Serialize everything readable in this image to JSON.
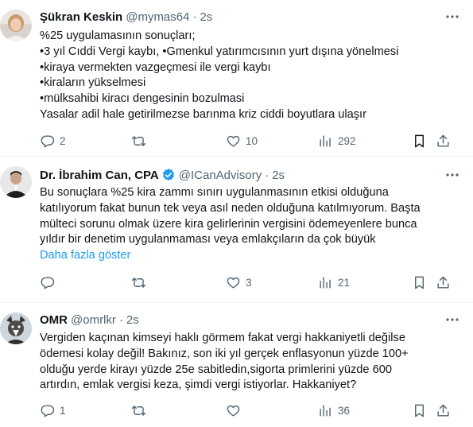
{
  "tweets": [
    {
      "name": "Şükran Keskin",
      "handle": "@mymas64",
      "dot": "·",
      "time": "2s",
      "lines": [
        "%25 uygulamasının sonuçları;",
        "•3 yıl Cıddi Vergi kaybı, •Gmenkul yatırımcısının yurt dışına yönelmesi",
        "•kiraya vermekten vazgeçmesi ile vergi kaybı",
        "•kiraların yükselmesi",
        "•mülksahibi kiracı dengesinin bozulmasi",
        "Yasalar adil hale getirilmezse barınma kriz ciddi boyutlara ulaşır"
      ],
      "replies": "2",
      "retweets": "",
      "likes": "10",
      "views": "292"
    },
    {
      "name": "Dr. İbrahim Can, CPA",
      "handle": "@ICanAdvisory",
      "dot": "·",
      "time": "2s",
      "verified": true,
      "lines": [
        "Bu sonuçlara %25 kira zammı sınırı uygulanmasının etkisi olduğuna",
        "katılıyorum fakat bunun tek veya asıl neden olduğuna katılmıyorum. Başta",
        "mülteci sorunu olmak üzere kira gelirlerinin vergisini ödemeyenlere bunca",
        "yıldır bir denetim uygulanmaması veya emlakçıların da çok büyük"
      ],
      "show_more": "Daha fazla göster",
      "replies": "",
      "retweets": "",
      "likes": "3",
      "views": "21"
    },
    {
      "name": "OMR",
      "handle": "@omrlkr",
      "dot": "·",
      "time": "2s",
      "lines": [
        "Vergiden kaçınan kimseyi haklı görmem fakat vergi hakkaniyetli değilse",
        "ödemesi kolay değil! Bakınız, son iki yıl gerçek enflasyonun yüzde 100+",
        "olduğu yerde kirayı yüzde 25e sabitledin,sigorta primlerini yüzde 600",
        "artırdın, emlak vergisi keza, şimdi vergi istiyorlar. Hakkaniyet?"
      ],
      "replies": "1",
      "retweets": "",
      "likes": "",
      "views": "36"
    }
  ],
  "icons": {
    "reply": "reply-icon",
    "retweet": "retweet-icon",
    "like": "heart-icon",
    "views": "views-icon",
    "bookmark": "bookmark-icon",
    "share": "share-icon",
    "more": "more-icon",
    "verified": "verified-badge-icon"
  },
  "colors": {
    "text": "#0f1419",
    "secondary": "#536471",
    "link": "#1d9bf0",
    "verified": "#1d9bf0",
    "divider": "#eff3f4"
  }
}
